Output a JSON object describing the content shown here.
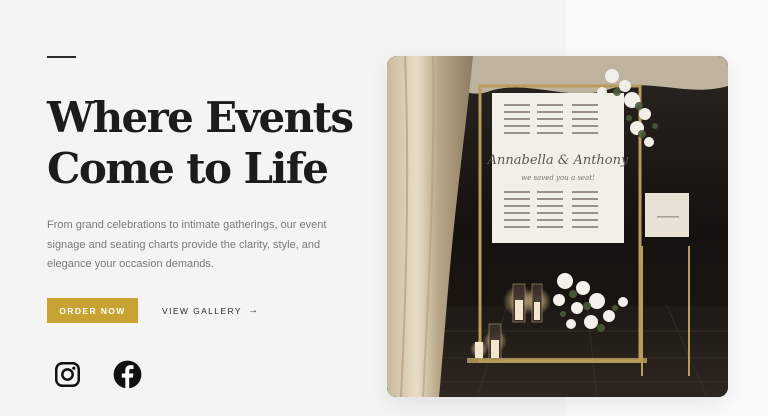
{
  "hero": {
    "title_line1": "Where Events",
    "title_line2": "Come to Life",
    "description": "From grand celebrations to intimate gatherings, our event signage and seating charts provide the clarity, style, and elegance your occasion demands."
  },
  "actions": {
    "order_label": "ORDER NOW",
    "gallery_label": "VIEW GALLERY",
    "gallery_arrow": "→"
  },
  "social": {
    "icons": [
      "instagram-icon",
      "facebook-icon"
    ]
  },
  "photo": {
    "sign_names": "Annabella & Anthony",
    "sign_tagline": "we saved you a seat!"
  },
  "colors": {
    "accent": "#c8a233",
    "text_dark": "#1c1c1c",
    "text_muted": "#7a7a7a",
    "background": "#f4f4f4"
  }
}
